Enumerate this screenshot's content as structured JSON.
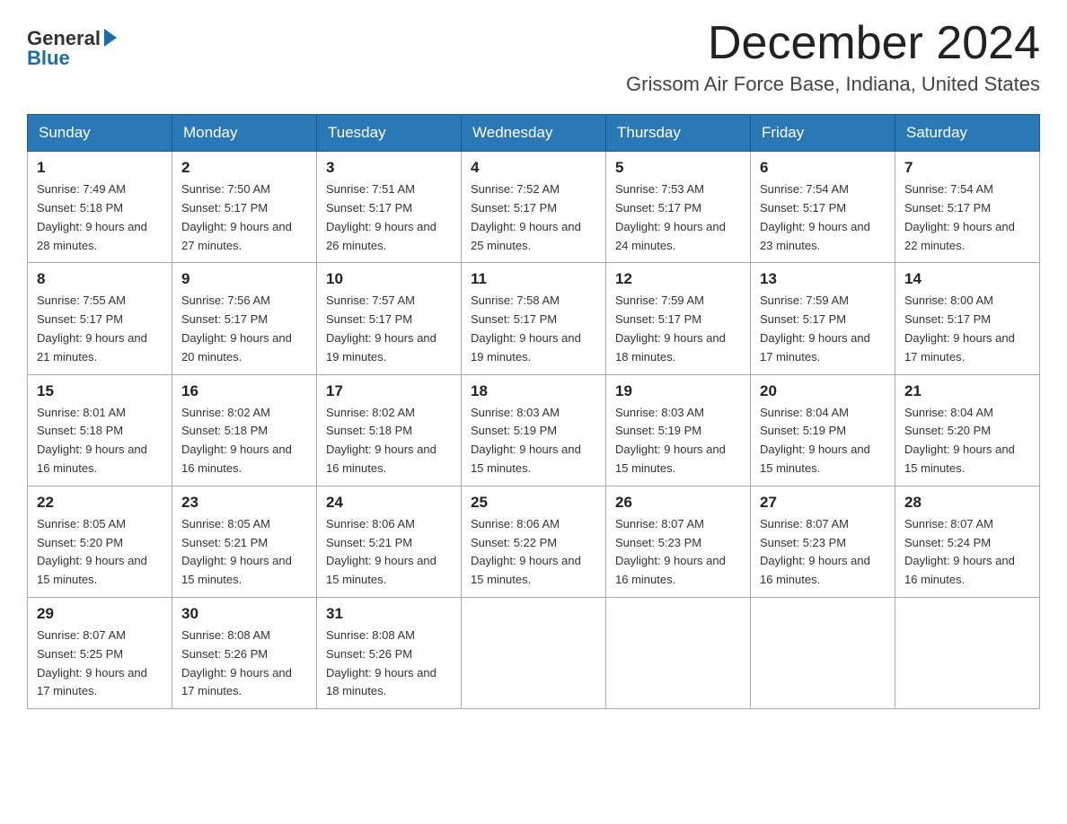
{
  "header": {
    "logo_general": "General",
    "logo_blue": "Blue",
    "month_title": "December 2024",
    "location": "Grissom Air Force Base, Indiana, United States"
  },
  "weekdays": [
    "Sunday",
    "Monday",
    "Tuesday",
    "Wednesday",
    "Thursday",
    "Friday",
    "Saturday"
  ],
  "weeks": [
    [
      {
        "day": "1",
        "sunrise": "7:49 AM",
        "sunset": "5:18 PM",
        "daylight": "9 hours and 28 minutes."
      },
      {
        "day": "2",
        "sunrise": "7:50 AM",
        "sunset": "5:17 PM",
        "daylight": "9 hours and 27 minutes."
      },
      {
        "day": "3",
        "sunrise": "7:51 AM",
        "sunset": "5:17 PM",
        "daylight": "9 hours and 26 minutes."
      },
      {
        "day": "4",
        "sunrise": "7:52 AM",
        "sunset": "5:17 PM",
        "daylight": "9 hours and 25 minutes."
      },
      {
        "day": "5",
        "sunrise": "7:53 AM",
        "sunset": "5:17 PM",
        "daylight": "9 hours and 24 minutes."
      },
      {
        "day": "6",
        "sunrise": "7:54 AM",
        "sunset": "5:17 PM",
        "daylight": "9 hours and 23 minutes."
      },
      {
        "day": "7",
        "sunrise": "7:54 AM",
        "sunset": "5:17 PM",
        "daylight": "9 hours and 22 minutes."
      }
    ],
    [
      {
        "day": "8",
        "sunrise": "7:55 AM",
        "sunset": "5:17 PM",
        "daylight": "9 hours and 21 minutes."
      },
      {
        "day": "9",
        "sunrise": "7:56 AM",
        "sunset": "5:17 PM",
        "daylight": "9 hours and 20 minutes."
      },
      {
        "day": "10",
        "sunrise": "7:57 AM",
        "sunset": "5:17 PM",
        "daylight": "9 hours and 19 minutes."
      },
      {
        "day": "11",
        "sunrise": "7:58 AM",
        "sunset": "5:17 PM",
        "daylight": "9 hours and 19 minutes."
      },
      {
        "day": "12",
        "sunrise": "7:59 AM",
        "sunset": "5:17 PM",
        "daylight": "9 hours and 18 minutes."
      },
      {
        "day": "13",
        "sunrise": "7:59 AM",
        "sunset": "5:17 PM",
        "daylight": "9 hours and 17 minutes."
      },
      {
        "day": "14",
        "sunrise": "8:00 AM",
        "sunset": "5:17 PM",
        "daylight": "9 hours and 17 minutes."
      }
    ],
    [
      {
        "day": "15",
        "sunrise": "8:01 AM",
        "sunset": "5:18 PM",
        "daylight": "9 hours and 16 minutes."
      },
      {
        "day": "16",
        "sunrise": "8:02 AM",
        "sunset": "5:18 PM",
        "daylight": "9 hours and 16 minutes."
      },
      {
        "day": "17",
        "sunrise": "8:02 AM",
        "sunset": "5:18 PM",
        "daylight": "9 hours and 16 minutes."
      },
      {
        "day": "18",
        "sunrise": "8:03 AM",
        "sunset": "5:19 PM",
        "daylight": "9 hours and 15 minutes."
      },
      {
        "day": "19",
        "sunrise": "8:03 AM",
        "sunset": "5:19 PM",
        "daylight": "9 hours and 15 minutes."
      },
      {
        "day": "20",
        "sunrise": "8:04 AM",
        "sunset": "5:19 PM",
        "daylight": "9 hours and 15 minutes."
      },
      {
        "day": "21",
        "sunrise": "8:04 AM",
        "sunset": "5:20 PM",
        "daylight": "9 hours and 15 minutes."
      }
    ],
    [
      {
        "day": "22",
        "sunrise": "8:05 AM",
        "sunset": "5:20 PM",
        "daylight": "9 hours and 15 minutes."
      },
      {
        "day": "23",
        "sunrise": "8:05 AM",
        "sunset": "5:21 PM",
        "daylight": "9 hours and 15 minutes."
      },
      {
        "day": "24",
        "sunrise": "8:06 AM",
        "sunset": "5:21 PM",
        "daylight": "9 hours and 15 minutes."
      },
      {
        "day": "25",
        "sunrise": "8:06 AM",
        "sunset": "5:22 PM",
        "daylight": "9 hours and 15 minutes."
      },
      {
        "day": "26",
        "sunrise": "8:07 AM",
        "sunset": "5:23 PM",
        "daylight": "9 hours and 16 minutes."
      },
      {
        "day": "27",
        "sunrise": "8:07 AM",
        "sunset": "5:23 PM",
        "daylight": "9 hours and 16 minutes."
      },
      {
        "day": "28",
        "sunrise": "8:07 AM",
        "sunset": "5:24 PM",
        "daylight": "9 hours and 16 minutes."
      }
    ],
    [
      {
        "day": "29",
        "sunrise": "8:07 AM",
        "sunset": "5:25 PM",
        "daylight": "9 hours and 17 minutes."
      },
      {
        "day": "30",
        "sunrise": "8:08 AM",
        "sunset": "5:26 PM",
        "daylight": "9 hours and 17 minutes."
      },
      {
        "day": "31",
        "sunrise": "8:08 AM",
        "sunset": "5:26 PM",
        "daylight": "9 hours and 18 minutes."
      },
      null,
      null,
      null,
      null
    ]
  ]
}
